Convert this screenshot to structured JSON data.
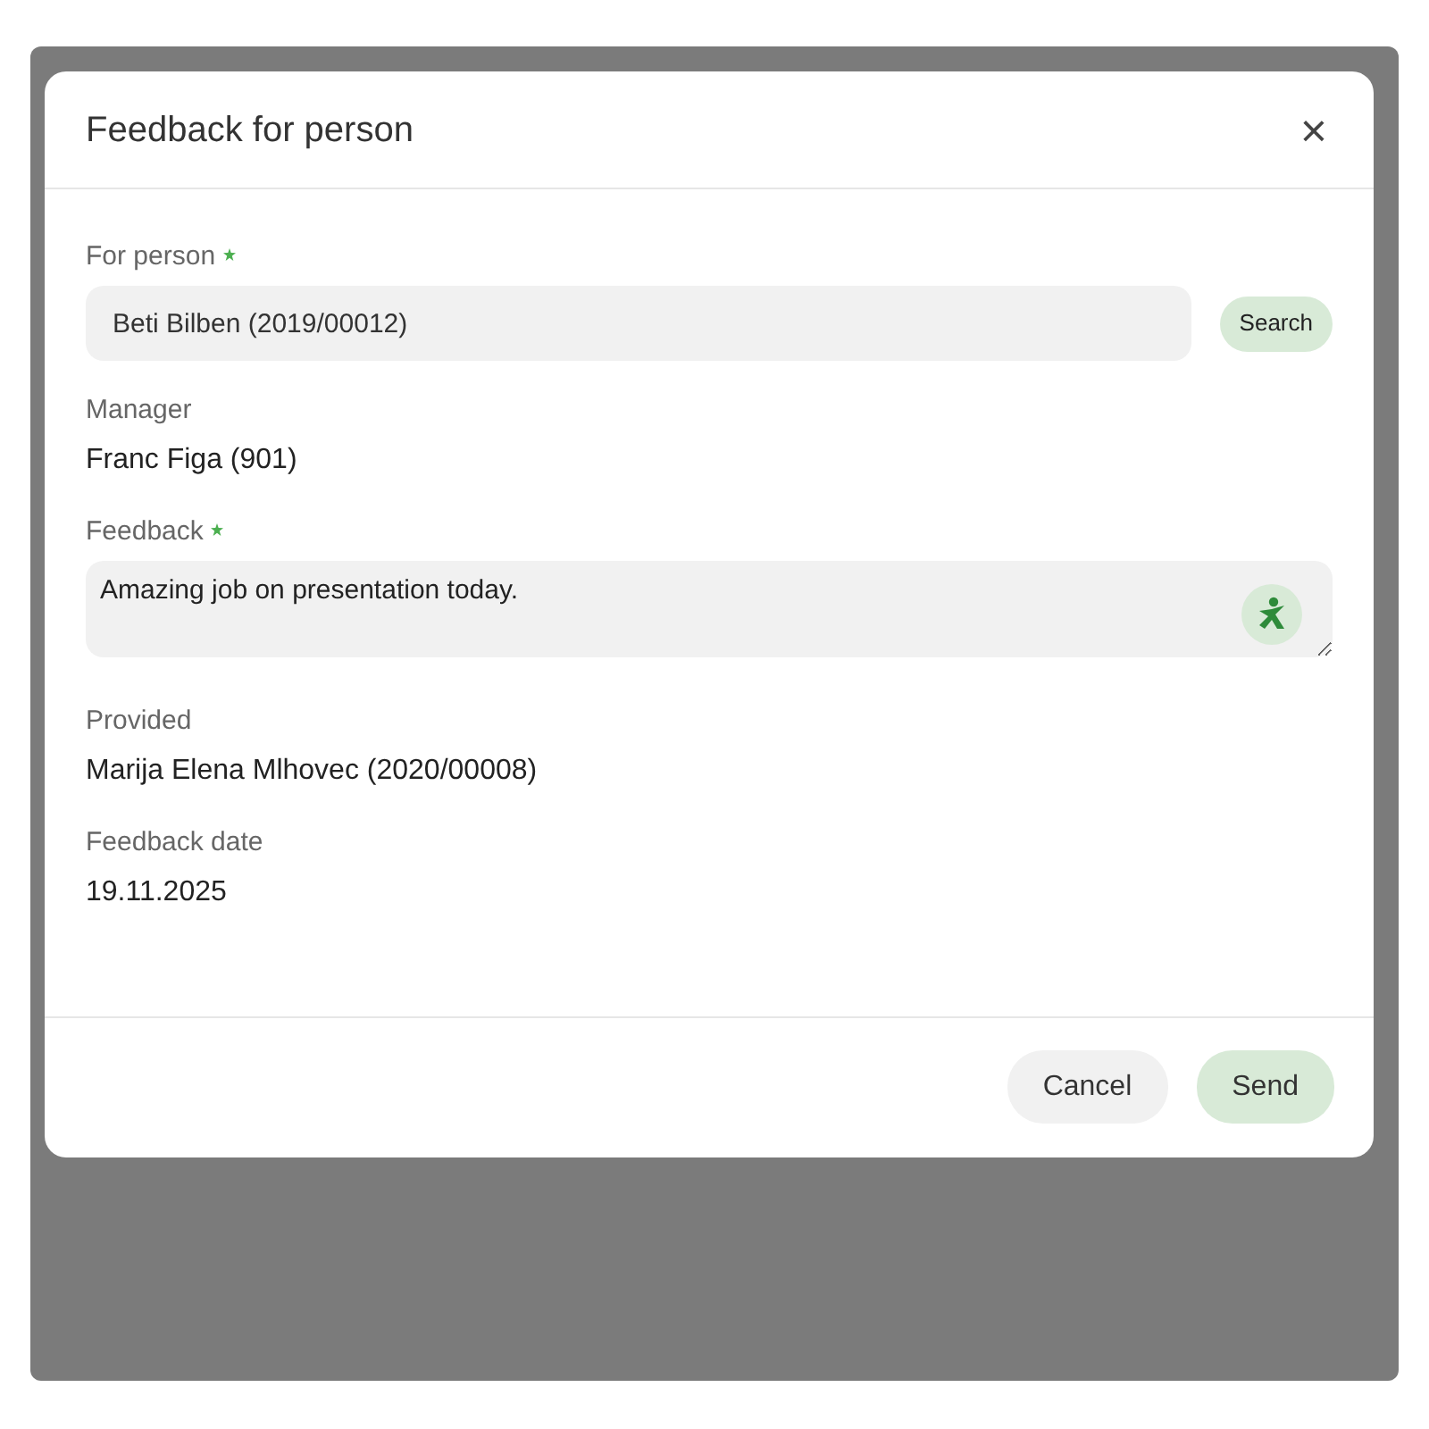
{
  "dialog": {
    "title": "Feedback for person",
    "close": "×"
  },
  "fields": [
    {
      "kind": "select",
      "label": "For person",
      "required": true,
      "value": "Beti Bilben (2019/00012)",
      "button": "Search"
    },
    {
      "kind": "static",
      "label": "Manager",
      "required": false,
      "value": "Franc Figa (901)"
    },
    {
      "kind": "textarea",
      "label": "Feedback",
      "required": true,
      "value": "Amazing job on presentation today."
    },
    {
      "kind": "static",
      "label": "Provided",
      "required": false,
      "value": "Marija Elena Mlhovec (2020/00008)"
    },
    {
      "kind": "static",
      "label": "Feedback date",
      "required": false,
      "value": "19.11.2025"
    }
  ],
  "buttons": [
    {
      "label": "Cancel",
      "kind": "secondary"
    },
    {
      "label": "Send",
      "kind": "primary"
    }
  ]
}
